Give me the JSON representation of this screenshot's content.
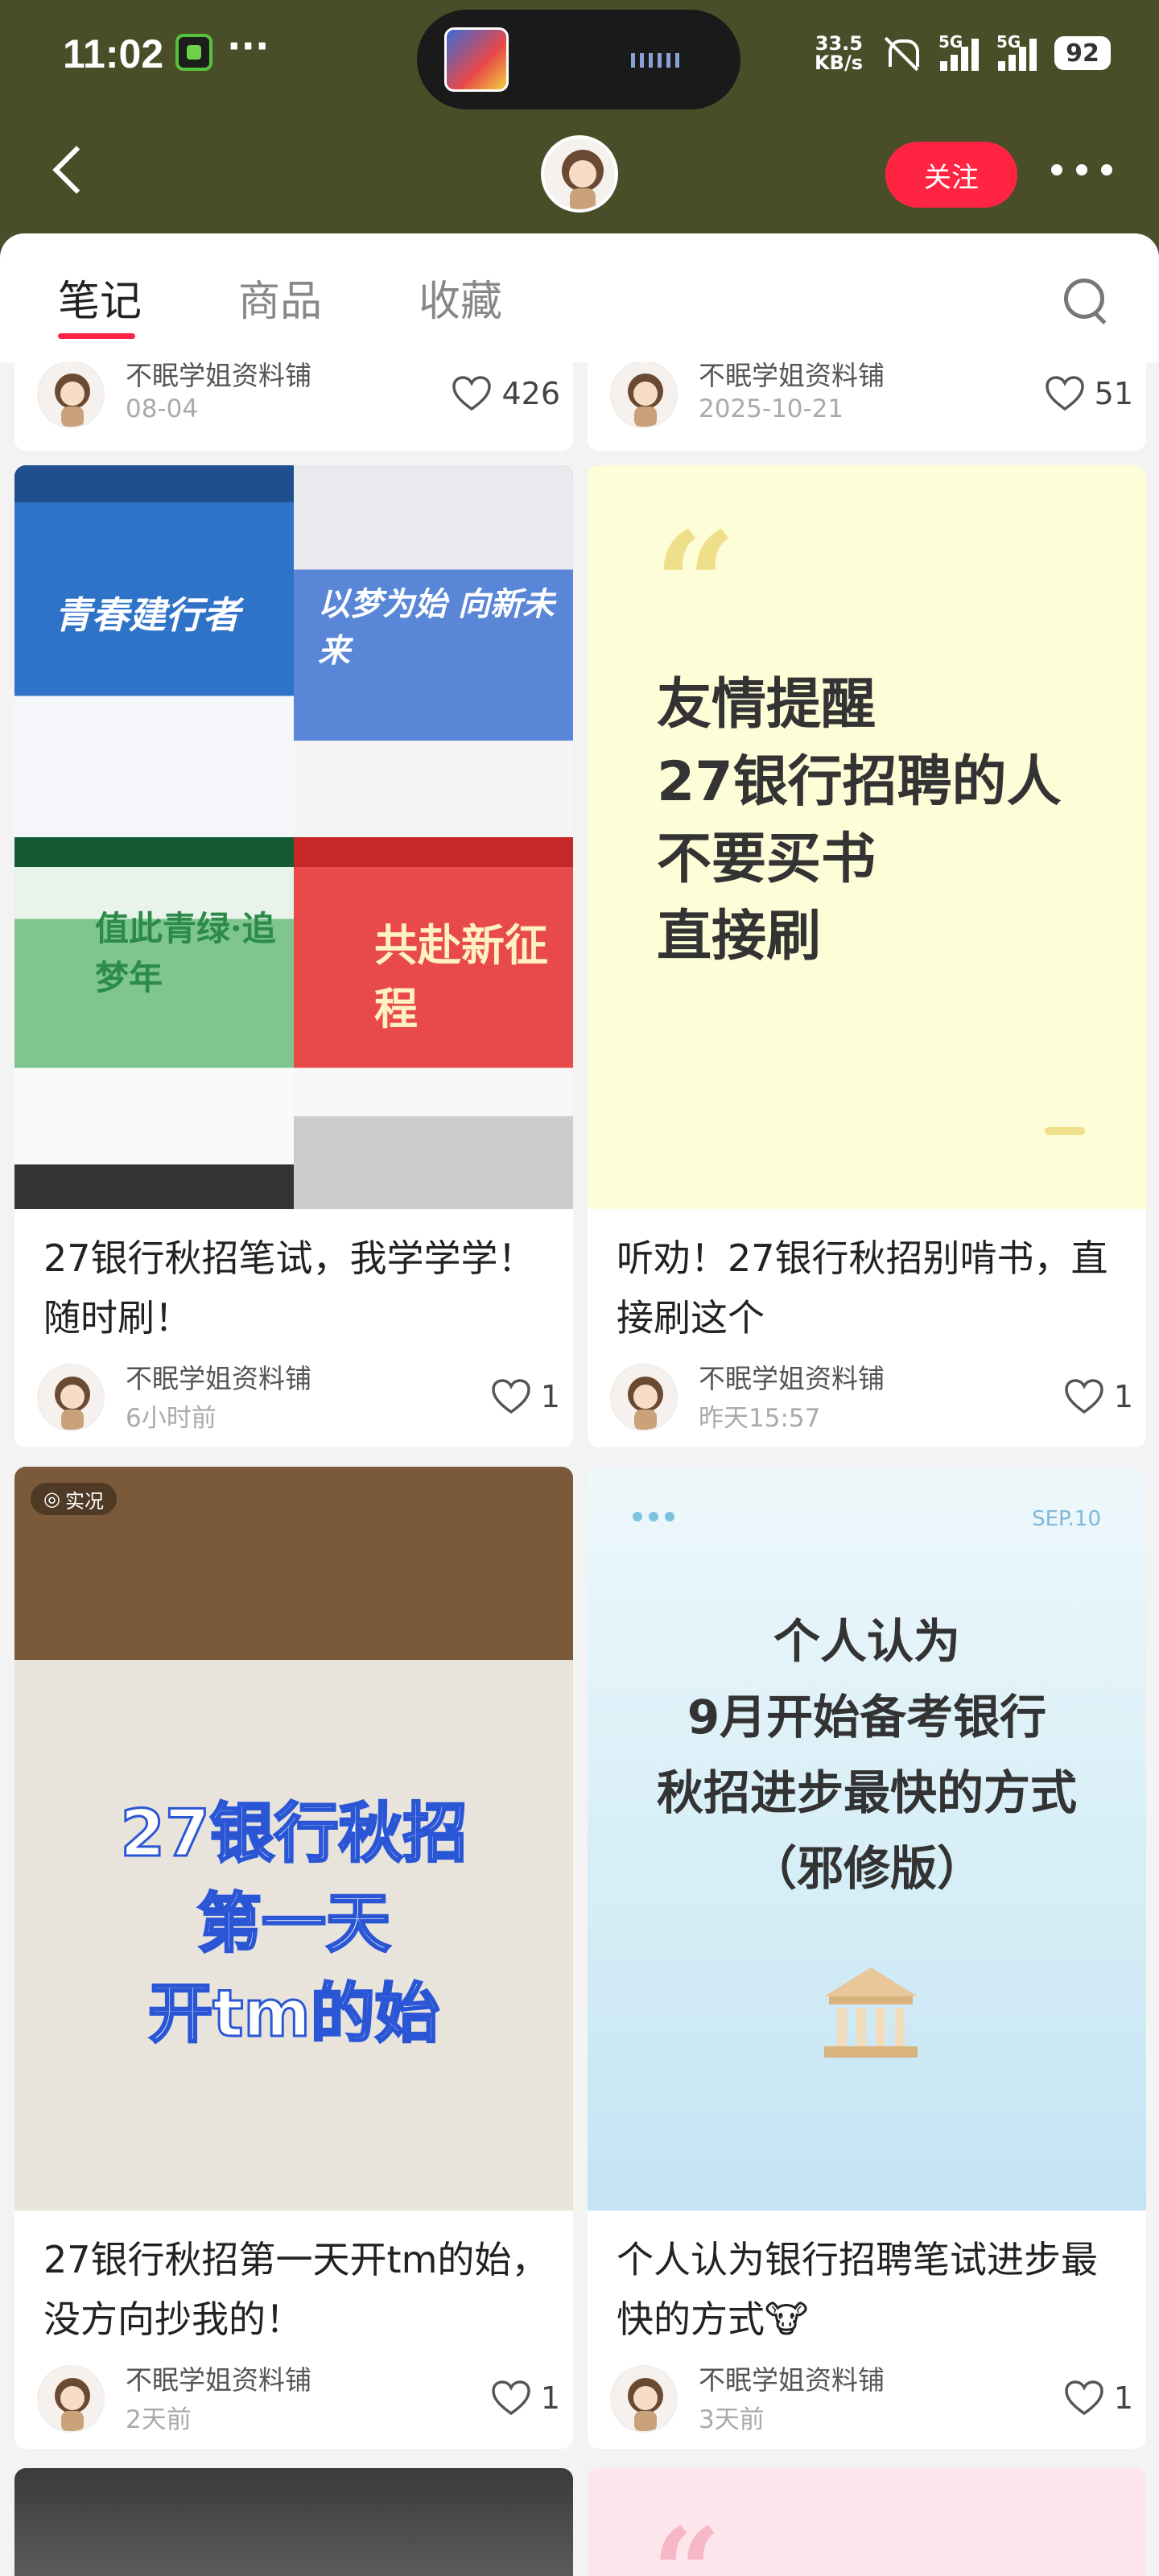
{
  "status_bar": {
    "time": "11:02",
    "net_speed_value": "33.5",
    "net_speed_unit": "KB/s",
    "signal_1": "5G",
    "signal_2": "5G",
    "battery": "92"
  },
  "header": {
    "follow_label": "关注"
  },
  "tabs": [
    {
      "label": "笔记",
      "active": true
    },
    {
      "label": "商品",
      "active": false
    },
    {
      "label": "收藏",
      "active": false
    }
  ],
  "notes": [
    {
      "author": "不眠学姐资料铺",
      "date": "08-04",
      "likes": "426"
    },
    {
      "author": "不眠学姐资料铺",
      "date": "2025-10-21",
      "likes": "51"
    },
    {
      "title": "27银行秋招笔试，我学学学！随时刷！",
      "author": "不眠学姐资料铺",
      "date": "6小时前",
      "likes": "1",
      "cover_labels": [
        "青春建行者",
        "以梦为始 向新未来",
        "值此青绿·追梦年",
        "共赴新征程"
      ]
    },
    {
      "title": "听劝！27银行秋招别啃书，直接刷这个",
      "author": "不眠学姐资料铺",
      "date": "昨天15:57",
      "likes": "1",
      "cover_text": "友情提醒\n27银行招聘的人\n不要买书\n直接刷"
    },
    {
      "title": "27银行秋招第一天开tm的始，没方向抄我的！",
      "author": "不眠学姐资料铺",
      "date": "2天前",
      "likes": "1",
      "live_label": "实况",
      "cover_text": "27银行秋招\n第一天\n开tm的始"
    },
    {
      "title": "个人认为银行招聘笔试进步最快的方式🐮",
      "author": "不眠学姐资料铺",
      "date": "3天前",
      "likes": "1",
      "sep_label": "SEP.10",
      "cover_text": "个人认为\n9月开始备考银行\n秋招进步最快的方式\n（邪修版）"
    }
  ],
  "colors": {
    "header_bg": "#494e29",
    "accent": "#ff2442",
    "feed_bg": "#f3f3f3"
  }
}
